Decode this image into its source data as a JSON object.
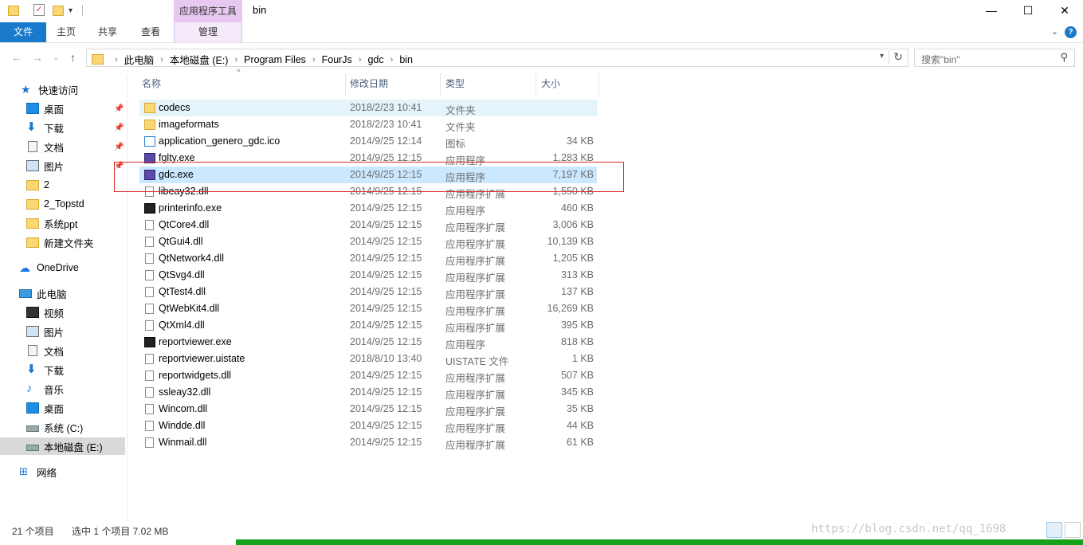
{
  "window": {
    "title": "bin",
    "context_tab_head": "应用程序工具",
    "minimize": "—",
    "maximize": "☐",
    "close": "✕"
  },
  "ribbon": {
    "tabs": [
      "文件",
      "主页",
      "共享",
      "查看",
      "管理"
    ],
    "expand_icon": "chevron-down-icon",
    "accent_color": "#1979ca",
    "context_color": "#e6c8f0"
  },
  "address": {
    "crumbs": [
      "此电脑",
      "本地磁盘 (E:)",
      "Program Files",
      "FourJs",
      "gdc",
      "bin"
    ],
    "search_placeholder": "搜索\"bin\""
  },
  "nav_pane": {
    "items": [
      {
        "label": "快速访问",
        "icon": "star-icon"
      },
      {
        "label": "桌面",
        "icon": "desktop-icon",
        "pinned": true
      },
      {
        "label": "下载",
        "icon": "download-icon",
        "pinned": true
      },
      {
        "label": "文档",
        "icon": "document-icon",
        "pinned": true
      },
      {
        "label": "图片",
        "icon": "pictures-icon",
        "pinned": true
      },
      {
        "label": "2",
        "icon": "folder-icon"
      },
      {
        "label": "2_Topstd",
        "icon": "folder-icon"
      },
      {
        "label": "系统ppt",
        "icon": "folder-icon"
      },
      {
        "label": "新建文件夹",
        "icon": "folder-icon"
      },
      {
        "label": "OneDrive",
        "icon": "cloud-icon"
      },
      {
        "label": "此电脑",
        "icon": "computer-icon"
      },
      {
        "label": "视频",
        "icon": "video-icon"
      },
      {
        "label": "图片",
        "icon": "pictures-icon"
      },
      {
        "label": "文档",
        "icon": "document-icon"
      },
      {
        "label": "下载",
        "icon": "download-icon"
      },
      {
        "label": "音乐",
        "icon": "music-icon"
      },
      {
        "label": "桌面",
        "icon": "desktop-icon"
      },
      {
        "label": "系统 (C:)",
        "icon": "drive-icon"
      },
      {
        "label": "本地磁盘 (E:)",
        "icon": "drive-icon",
        "selected": true
      },
      {
        "label": "网络",
        "icon": "network-icon"
      }
    ]
  },
  "columns": {
    "name": "名称",
    "date": "修改日期",
    "type": "类型",
    "size": "大小"
  },
  "files": [
    {
      "name": "codecs",
      "date": "2018/2/23 10:41",
      "type": "文件夹",
      "size": "",
      "icon": "folder-icon",
      "state": "hover"
    },
    {
      "name": "imageformats",
      "date": "2018/2/23 10:41",
      "type": "文件夹",
      "size": "",
      "icon": "folder-icon"
    },
    {
      "name": "application_genero_gdc.ico",
      "date": "2014/9/25 12:14",
      "type": "图标",
      "size": "34 KB",
      "icon": "ico-file-icon"
    },
    {
      "name": "fglty.exe",
      "date": "2014/9/25 12:15",
      "type": "应用程序",
      "size": "1,283 KB",
      "icon": "exe-icon"
    },
    {
      "name": "gdc.exe",
      "date": "2014/9/25 12:15",
      "type": "应用程序",
      "size": "7,197 KB",
      "icon": "exe-icon",
      "state": "selected"
    },
    {
      "name": "libeay32.dll",
      "date": "2014/9/25 12:15",
      "type": "应用程序扩展",
      "size": "1,550 KB",
      "icon": "dll-icon"
    },
    {
      "name": "printerinfo.exe",
      "date": "2014/9/25 12:15",
      "type": "应用程序",
      "size": "460 KB",
      "icon": "exe-dark-icon"
    },
    {
      "name": "QtCore4.dll",
      "date": "2014/9/25 12:15",
      "type": "应用程序扩展",
      "size": "3,006 KB",
      "icon": "dll-icon"
    },
    {
      "name": "QtGui4.dll",
      "date": "2014/9/25 12:15",
      "type": "应用程序扩展",
      "size": "10,139 KB",
      "icon": "dll-icon"
    },
    {
      "name": "QtNetwork4.dll",
      "date": "2014/9/25 12:15",
      "type": "应用程序扩展",
      "size": "1,205 KB",
      "icon": "dll-icon"
    },
    {
      "name": "QtSvg4.dll",
      "date": "2014/9/25 12:15",
      "type": "应用程序扩展",
      "size": "313 KB",
      "icon": "dll-icon"
    },
    {
      "name": "QtTest4.dll",
      "date": "2014/9/25 12:15",
      "type": "应用程序扩展",
      "size": "137 KB",
      "icon": "dll-icon"
    },
    {
      "name": "QtWebKit4.dll",
      "date": "2014/9/25 12:15",
      "type": "应用程序扩展",
      "size": "16,269 KB",
      "icon": "dll-icon"
    },
    {
      "name": "QtXml4.dll",
      "date": "2014/9/25 12:15",
      "type": "应用程序扩展",
      "size": "395 KB",
      "icon": "dll-icon"
    },
    {
      "name": "reportviewer.exe",
      "date": "2014/9/25 12:15",
      "type": "应用程序",
      "size": "818 KB",
      "icon": "exe-dark-icon"
    },
    {
      "name": "reportviewer.uistate",
      "date": "2018/8/10 13:40",
      "type": "UISTATE 文件",
      "size": "1 KB",
      "icon": "file-icon"
    },
    {
      "name": "reportwidgets.dll",
      "date": "2014/9/25 12:15",
      "type": "应用程序扩展",
      "size": "507 KB",
      "icon": "dll-icon"
    },
    {
      "name": "ssleay32.dll",
      "date": "2014/9/25 12:15",
      "type": "应用程序扩展",
      "size": "345 KB",
      "icon": "dll-icon"
    },
    {
      "name": "Wincom.dll",
      "date": "2014/9/25 12:15",
      "type": "应用程序扩展",
      "size": "35 KB",
      "icon": "dll-icon"
    },
    {
      "name": "Windde.dll",
      "date": "2014/9/25 12:15",
      "type": "应用程序扩展",
      "size": "44 KB",
      "icon": "dll-icon"
    },
    {
      "name": "Winmail.dll",
      "date": "2014/9/25 12:15",
      "type": "应用程序扩展",
      "size": "61 KB",
      "icon": "dll-icon"
    }
  ],
  "status": {
    "count": "21 个项目",
    "selection": "选中 1 个项目  7.02 MB"
  },
  "watermark": "https://blog.csdn.net/qq_1698"
}
